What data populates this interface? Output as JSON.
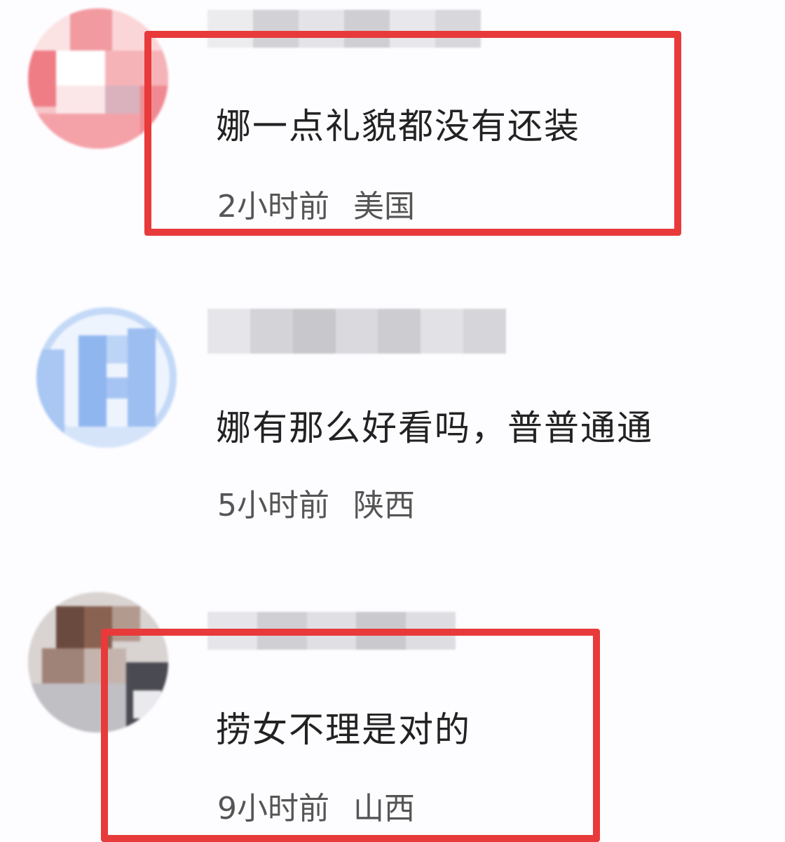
{
  "comments": [
    {
      "text": "娜一点礼貌都没有还装",
      "time": "2小时前",
      "location": "美国",
      "highlighted": true,
      "avatar_tone": "pink"
    },
    {
      "text": "娜有那么好看吗，普普通通",
      "time": "5小时前",
      "location": "陕西",
      "highlighted": false,
      "avatar_tone": "blue"
    },
    {
      "text": "捞女不理是对的",
      "time": "9小时前",
      "location": "山西",
      "highlighted": true,
      "avatar_tone": "brown"
    }
  ],
  "colors": {
    "highlight": "#e83a3a",
    "text": "#222222",
    "meta": "#555555",
    "background": "#fdfdff"
  }
}
